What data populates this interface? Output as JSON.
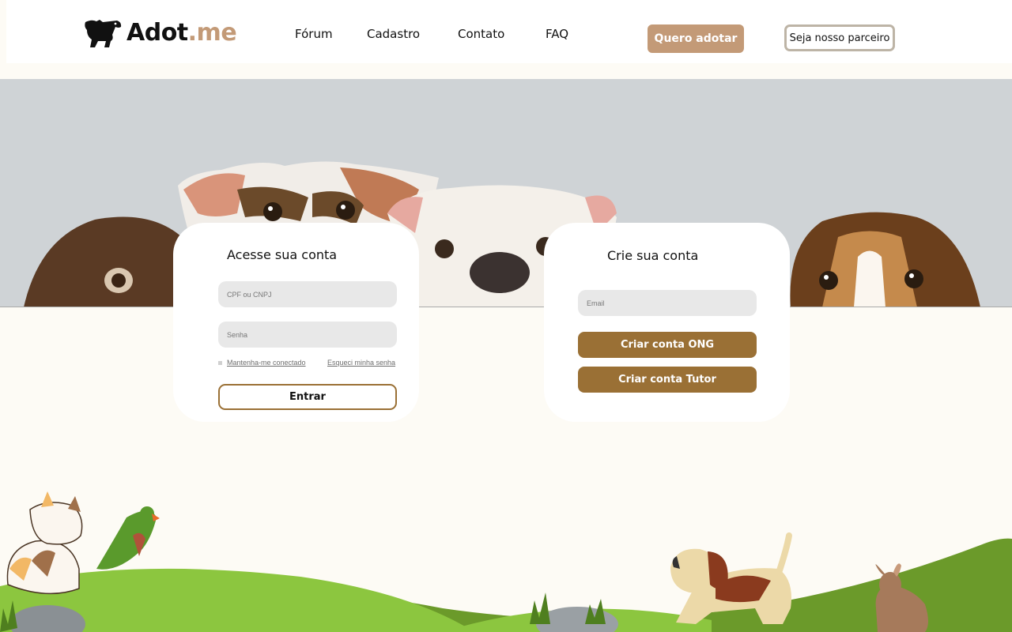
{
  "brand": {
    "name_part1": "Adot",
    "name_part2": ".me"
  },
  "nav": {
    "items": [
      "Fórum",
      "Cadastro",
      "Contato",
      "FAQ"
    ]
  },
  "header_buttons": {
    "adopt": "Quero adotar",
    "partner": "Seja nosso parceiro"
  },
  "login": {
    "title": "Acesse sua conta",
    "id_placeholder": "CPF ou CNPJ",
    "password_placeholder": "Senha",
    "remember_label": "Mantenha-me conectado",
    "forgot_label": "Esqueci minha senha",
    "submit_label": "Entrar"
  },
  "signup": {
    "title": "Crie sua conta",
    "email_placeholder": "Email",
    "ong_button": "Criar conta ONG",
    "tutor_button": "Criar conta Tutor"
  },
  "colors": {
    "accent": "#c39a77",
    "primary_brown": "#9a7035",
    "background": "#fdfbf5",
    "grass": "#8cc63f"
  }
}
